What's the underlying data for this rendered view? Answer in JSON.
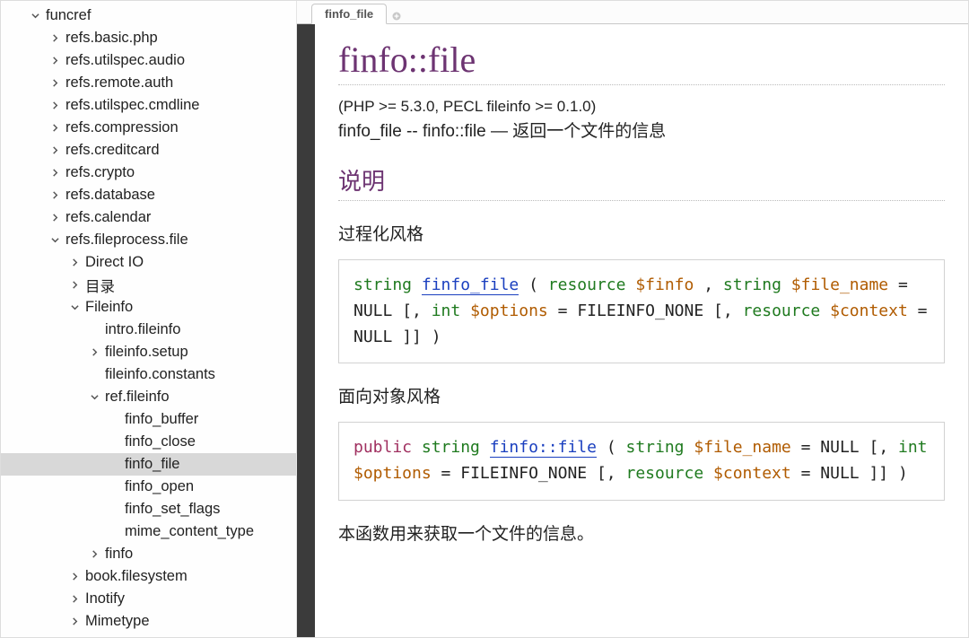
{
  "tab": {
    "label": "finfo_file"
  },
  "page": {
    "title": "finfo::file",
    "version": "(PHP >= 5.3.0, PECL fileinfo >= 0.1.0)",
    "synopsis": "finfo_file -- finfo::file — 返回一个文件的信息",
    "section_desc_heading": "说明",
    "style_proc_heading": "过程化风格",
    "style_oop_heading": "面向对象风格",
    "footer_sentence": "本函数用来获取一个文件的信息。"
  },
  "sig_proc": {
    "ret": "string",
    "name": "finfo_file",
    "a1_type": "resource",
    "a1_var": "$finfo",
    "a2_type": "string",
    "a2_var": "$file_name",
    "a2_def": "NULL",
    "a3_type": "int",
    "a3_var": "$options",
    "a3_def": "FILEINFO_NONE",
    "a4_type": "resource",
    "a4_var": "$context",
    "a4_def": "NULL"
  },
  "sig_oop": {
    "vis": "public",
    "ret": "string",
    "name": "finfo::file",
    "a1_type": "string",
    "a1_var": "$file_name",
    "a1_def": "NULL",
    "a2_type": "int",
    "a2_var": "$options",
    "a2_def": "FILEINFO_NONE",
    "a3_type": "resource",
    "a3_var": "$context",
    "a3_def": "NULL"
  },
  "tree": [
    {
      "indent": 0,
      "arrow": "down",
      "label": "funcref"
    },
    {
      "indent": 1,
      "arrow": "right",
      "label": "refs.basic.php"
    },
    {
      "indent": 1,
      "arrow": "right",
      "label": "refs.utilspec.audio"
    },
    {
      "indent": 1,
      "arrow": "right",
      "label": "refs.remote.auth"
    },
    {
      "indent": 1,
      "arrow": "right",
      "label": "refs.utilspec.cmdline"
    },
    {
      "indent": 1,
      "arrow": "right",
      "label": "refs.compression"
    },
    {
      "indent": 1,
      "arrow": "right",
      "label": "refs.creditcard"
    },
    {
      "indent": 1,
      "arrow": "right",
      "label": "refs.crypto"
    },
    {
      "indent": 1,
      "arrow": "right",
      "label": "refs.database"
    },
    {
      "indent": 1,
      "arrow": "right",
      "label": "refs.calendar"
    },
    {
      "indent": 1,
      "arrow": "down",
      "label": "refs.fileprocess.file"
    },
    {
      "indent": 2,
      "arrow": "right",
      "label": "Direct IO"
    },
    {
      "indent": 2,
      "arrow": "right",
      "label": "目录"
    },
    {
      "indent": 2,
      "arrow": "down",
      "label": "Fileinfo"
    },
    {
      "indent": 3,
      "arrow": "none",
      "label": "intro.fileinfo"
    },
    {
      "indent": 3,
      "arrow": "right",
      "label": "fileinfo.setup"
    },
    {
      "indent": 3,
      "arrow": "none",
      "label": "fileinfo.constants"
    },
    {
      "indent": 3,
      "arrow": "down",
      "label": "ref.fileinfo"
    },
    {
      "indent": 4,
      "arrow": "none",
      "label": "finfo_buffer"
    },
    {
      "indent": 4,
      "arrow": "none",
      "label": "finfo_close"
    },
    {
      "indent": 4,
      "arrow": "none",
      "label": "finfo_file",
      "selected": true
    },
    {
      "indent": 4,
      "arrow": "none",
      "label": "finfo_open"
    },
    {
      "indent": 4,
      "arrow": "none",
      "label": "finfo_set_flags"
    },
    {
      "indent": 4,
      "arrow": "none",
      "label": "mime_content_type"
    },
    {
      "indent": 3,
      "arrow": "right",
      "label": "finfo"
    },
    {
      "indent": 2,
      "arrow": "right",
      "label": "book.filesystem"
    },
    {
      "indent": 2,
      "arrow": "right",
      "label": "Inotify"
    },
    {
      "indent": 2,
      "arrow": "right",
      "label": "Mimetype"
    }
  ]
}
